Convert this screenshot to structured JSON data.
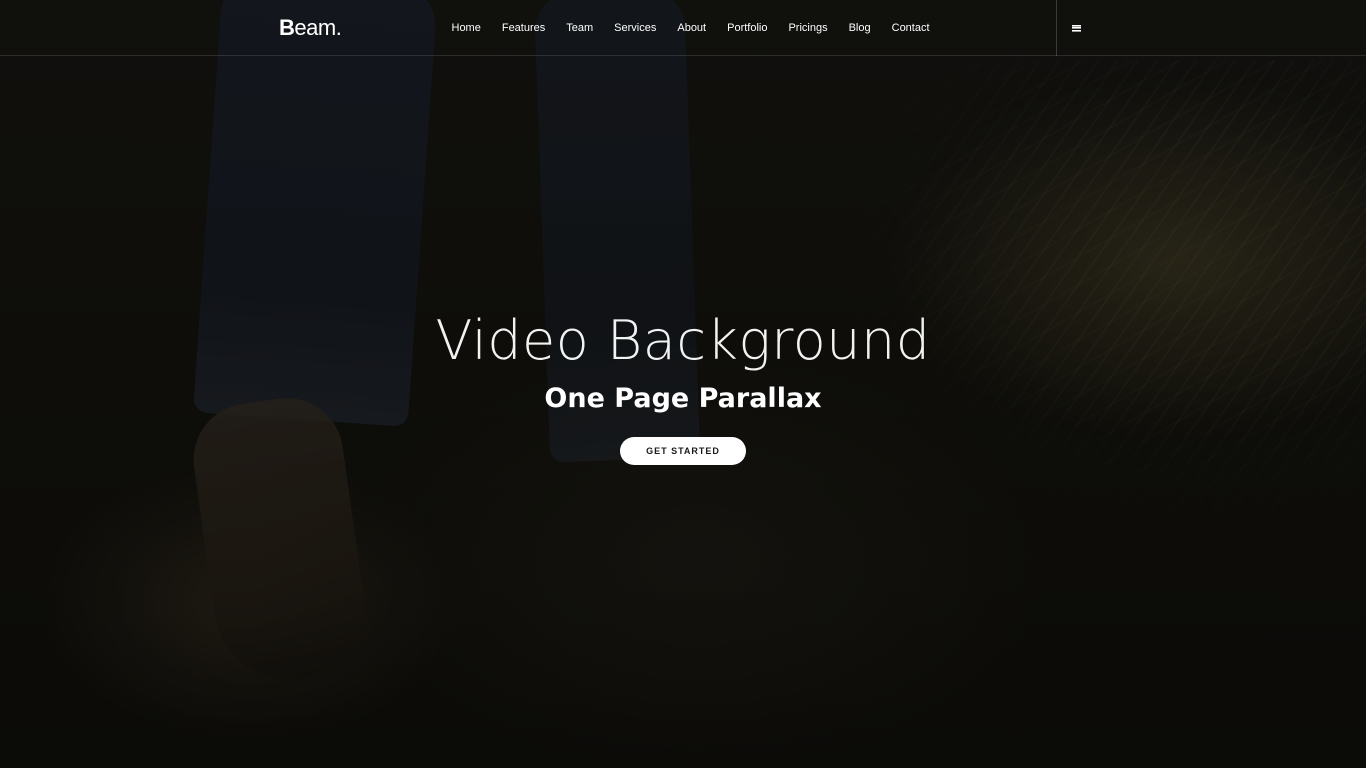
{
  "brand": {
    "logo_first": "B",
    "logo_rest": "eam."
  },
  "nav": {
    "items": [
      {
        "label": "Home"
      },
      {
        "label": "Features"
      },
      {
        "label": "Team"
      },
      {
        "label": "Services"
      },
      {
        "label": "About"
      },
      {
        "label": "Portfolio"
      },
      {
        "label": "Pricings"
      },
      {
        "label": "Blog"
      },
      {
        "label": "Contact"
      }
    ],
    "menu_icon": "hamburger-menu-icon"
  },
  "hero": {
    "title": "Video Background",
    "subtitle": "One Page Parallax",
    "cta_label": "GET STARTED"
  },
  "colors": {
    "text": "#ffffff",
    "button_bg": "#ffffff",
    "button_text": "#1a1a1a",
    "background": "#141310"
  }
}
